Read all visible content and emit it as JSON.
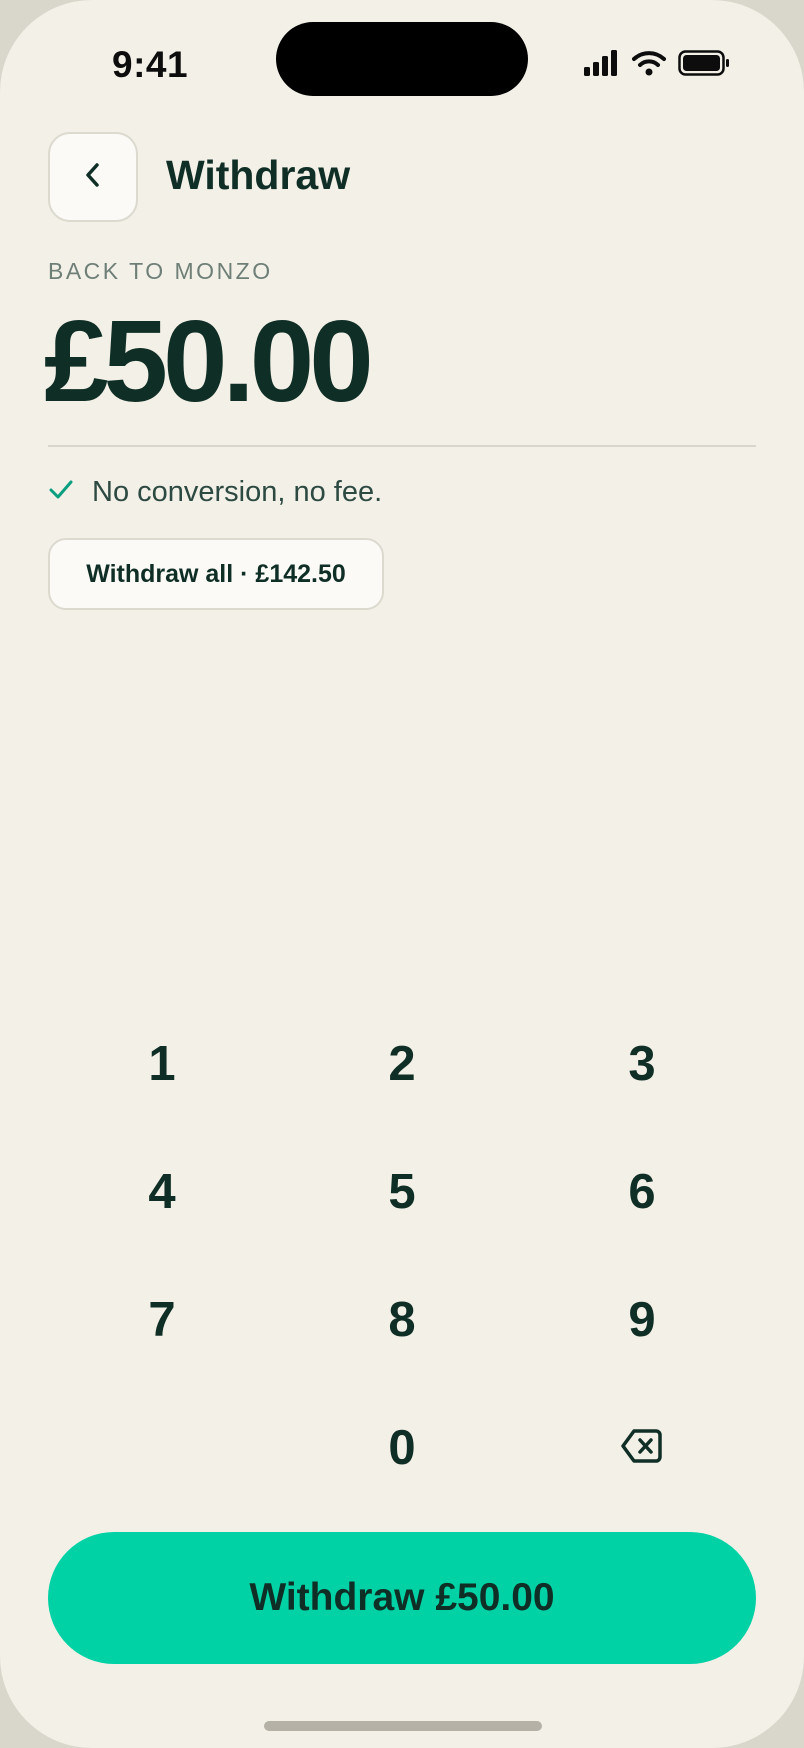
{
  "status_bar": {
    "time": "9:41",
    "icons": [
      "cellular-signal-icon",
      "wifi-icon",
      "battery-icon"
    ]
  },
  "header": {
    "back_icon": "chevron-left-icon",
    "title": "Withdraw"
  },
  "destination_label": "BACK TO MONZO",
  "amount": "£50.00",
  "fee_note": {
    "icon": "check-icon",
    "text": "No conversion, no fee."
  },
  "withdraw_all_button": {
    "label": "Withdraw all · £142.50"
  },
  "keypad": {
    "keys": [
      "1",
      "2",
      "3",
      "4",
      "5",
      "6",
      "7",
      "8",
      "9",
      "",
      "0"
    ],
    "backspace_icon": "backspace-icon"
  },
  "cta": {
    "label": "Withdraw £50.00"
  },
  "colors": {
    "background": "#f3f0e7",
    "text_primary": "#0f2e26",
    "accent": "#00d2a6",
    "check": "#0a9f7f"
  }
}
